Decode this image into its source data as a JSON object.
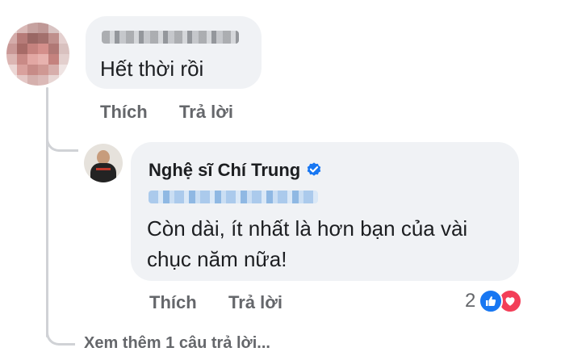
{
  "comment": {
    "text": "Hết thời rồi",
    "actions": {
      "like": "Thích",
      "reply": "Trả lời"
    }
  },
  "reply": {
    "author": "Nghệ sĩ Chí Trung",
    "verified": true,
    "text": "Còn dài, ít nhất là hơn bạn của vài chục năm nữa!",
    "actions": {
      "like": "Thích",
      "reply": "Trả lời"
    },
    "reaction_count": "2",
    "reaction_icons": [
      "like-icon",
      "love-icon"
    ]
  },
  "see_more": "Xem thêm 1 câu trả lời...",
  "colors": {
    "bubble": "#f0f2f5",
    "action_text": "#65676b",
    "verified": "#1877f2",
    "like": "#1877f2",
    "love": "#f33e58"
  }
}
